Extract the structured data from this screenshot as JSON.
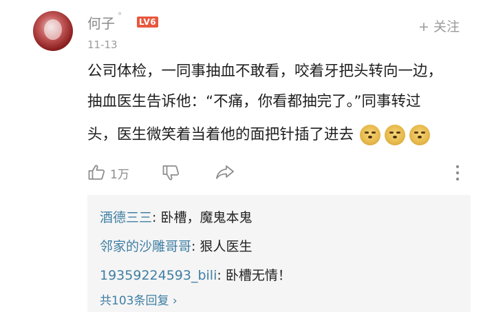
{
  "comment": {
    "username": "何子",
    "username_mark": "°",
    "level": "LV6",
    "date": "11-13",
    "follow_label": "+ 关注",
    "lines": [
      "公司体检，一同事抽血不敢看，咬着牙把头转向一边，",
      "抽血医生告诉他：“不痛，你看都抽完了。”同事转过",
      "头，医生微笑着当着他的面把针插了进去"
    ],
    "emojis": [
      "doge-emoji",
      "doge-emoji",
      "doge-emoji"
    ]
  },
  "actions": {
    "like_count": "1万",
    "icons": [
      "thumbs-up-icon",
      "thumbs-down-icon",
      "share-icon",
      "more-vertical-icon"
    ]
  },
  "replies": [
    {
      "name": "酒德三三",
      "text": ": 卧槽，魔鬼本鬼"
    },
    {
      "name": "邻家的沙雕哥哥",
      "text": ": 狠人医生"
    },
    {
      "name": "19359224593_bili",
      "text": ": 卧槽无情！"
    }
  ],
  "more_replies_label": "共103条回复 ›",
  "colors": {
    "accent_link": "#3f7ea3",
    "level_badge": "#e8573f",
    "reply_background": "#f5f5f5"
  }
}
